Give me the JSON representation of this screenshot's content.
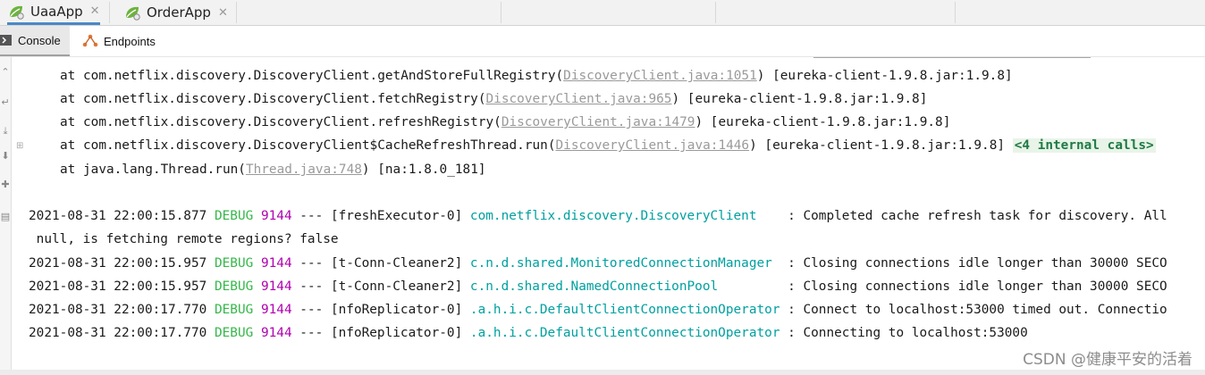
{
  "run_tabs": [
    {
      "label": "UaaApp",
      "icon": "spring-leaf-icon",
      "active": true
    },
    {
      "label": "OrderApp",
      "icon": "spring-leaf-icon",
      "active": false
    }
  ],
  "toolbar": {
    "console_label": "Console",
    "endpoints_label": "Endpoints"
  },
  "stack_trace": [
    {
      "prefix": "at com.netflix.discovery.DiscoveryClient.getAndStoreFullRegistry(",
      "link": "DiscoveryClient.java:1051",
      "suffix": ") [eureka-client-1.9.8.jar:1.9.8]"
    },
    {
      "prefix": "at com.netflix.discovery.DiscoveryClient.fetchRegistry(",
      "link": "DiscoveryClient.java:965",
      "suffix": ") [eureka-client-1.9.8.jar:1.9.8]"
    },
    {
      "prefix": "at com.netflix.discovery.DiscoveryClient.refreshRegistry(",
      "link": "DiscoveryClient.java:1479",
      "suffix": ") [eureka-client-1.9.8.jar:1.9.8]"
    },
    {
      "prefix": "at com.netflix.discovery.DiscoveryClient$CacheRefreshThread.run(",
      "link": "DiscoveryClient.java:1446",
      "suffix": ") [eureka-client-1.9.8.jar:1.9.8]",
      "extra": "<4 internal calls>"
    },
    {
      "prefix": "at java.lang.Thread.run(",
      "link": "Thread.java:748",
      "suffix": ") [na:1.8.0_181]"
    }
  ],
  "logs": [
    {
      "timestamp": "2021-08-31 22:00:15.877",
      "level": "DEBUG",
      "pid": "9144",
      "sep": "---",
      "thread": "[freshExecutor-0]",
      "logger": "com.netflix.discovery.DiscoveryClient   ",
      "message": ": Completed cache refresh task for discovery. All"
    },
    {
      "continuation": " null, is fetching remote regions? false"
    },
    {
      "timestamp": "2021-08-31 22:00:15.957",
      "level": "DEBUG",
      "pid": "9144",
      "sep": "---",
      "thread": "[t-Conn-Cleaner2]",
      "logger": "c.n.d.shared.MonitoredConnectionManager ",
      "message": ": Closing connections idle longer than 30000 SECO"
    },
    {
      "timestamp": "2021-08-31 22:00:15.957",
      "level": "DEBUG",
      "pid": "9144",
      "sep": "---",
      "thread": "[t-Conn-Cleaner2]",
      "logger": "c.n.d.shared.NamedConnectionPool        ",
      "message": ": Closing connections idle longer than 30000 SECO"
    },
    {
      "timestamp": "2021-08-31 22:00:17.770",
      "level": "DEBUG",
      "pid": "9144",
      "sep": "---",
      "thread": "[nfoReplicator-0]",
      "logger": ".a.h.i.c.DefaultClientConnectionOperator",
      "message": ": Connect to localhost:53000 timed out. Connectio"
    },
    {
      "timestamp": "2021-08-31 22:00:17.770",
      "level": "DEBUG",
      "pid": "9144",
      "sep": "---",
      "thread": "[nfoReplicator-0]",
      "logger": ".a.h.i.c.DefaultClientConnectionOperator",
      "message": ": Connecting to localhost:53000"
    }
  ],
  "watermark": "CSDN @健康平安的活着",
  "colors": {
    "debug": "#36b84a",
    "pid": "#b000b0",
    "logger": "#00a0a0",
    "link": "#9a9a9a",
    "accent": "#4a88c7"
  }
}
